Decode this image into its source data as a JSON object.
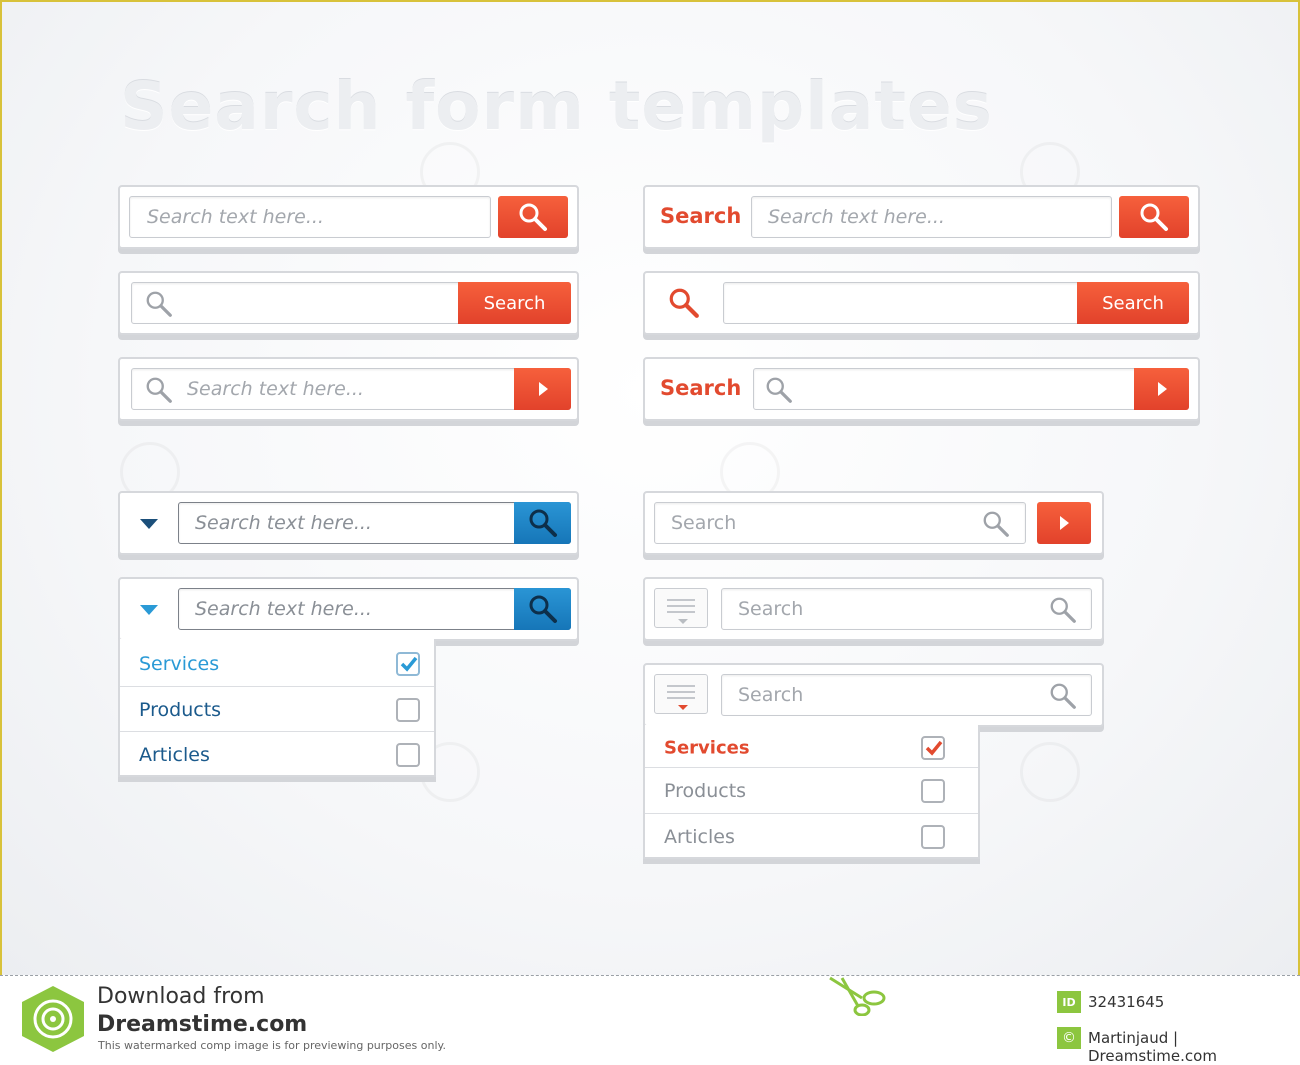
{
  "title": "Search form templates",
  "colors": {
    "accent_red": "#e8472e",
    "accent_blue": "#1b83c7",
    "dark_blue_text": "#1b5a8c",
    "light_blue_text": "#2a9ad6"
  },
  "placeholders": {
    "search_text": "Search text here...",
    "search": "Search"
  },
  "labels": {
    "search_button": "Search",
    "search_label": "Search"
  },
  "dropdown_blue": [
    {
      "label": "Services",
      "checked": true
    },
    {
      "label": "Products",
      "checked": false
    },
    {
      "label": "Articles",
      "checked": false
    }
  ],
  "dropdown_gray": [
    {
      "label": "Services",
      "checked": true
    },
    {
      "label": "Products",
      "checked": false
    },
    {
      "label": "Articles",
      "checked": false
    }
  ],
  "footer": {
    "download_from": "Download from",
    "site": "Dreamstime.com",
    "disclaimer": "This watermarked comp image is for previewing purposes only.",
    "id_badge": "ID",
    "image_id": "32431645",
    "author": "Martinjaud | Dreamstime.com"
  },
  "icons": [
    "magnifier-icon",
    "play-arrow-icon",
    "caret-down-icon",
    "menu-icon",
    "checkbox-icon",
    "scissors-icon",
    "dreamstime-logo-icon",
    "copyright-icon"
  ]
}
